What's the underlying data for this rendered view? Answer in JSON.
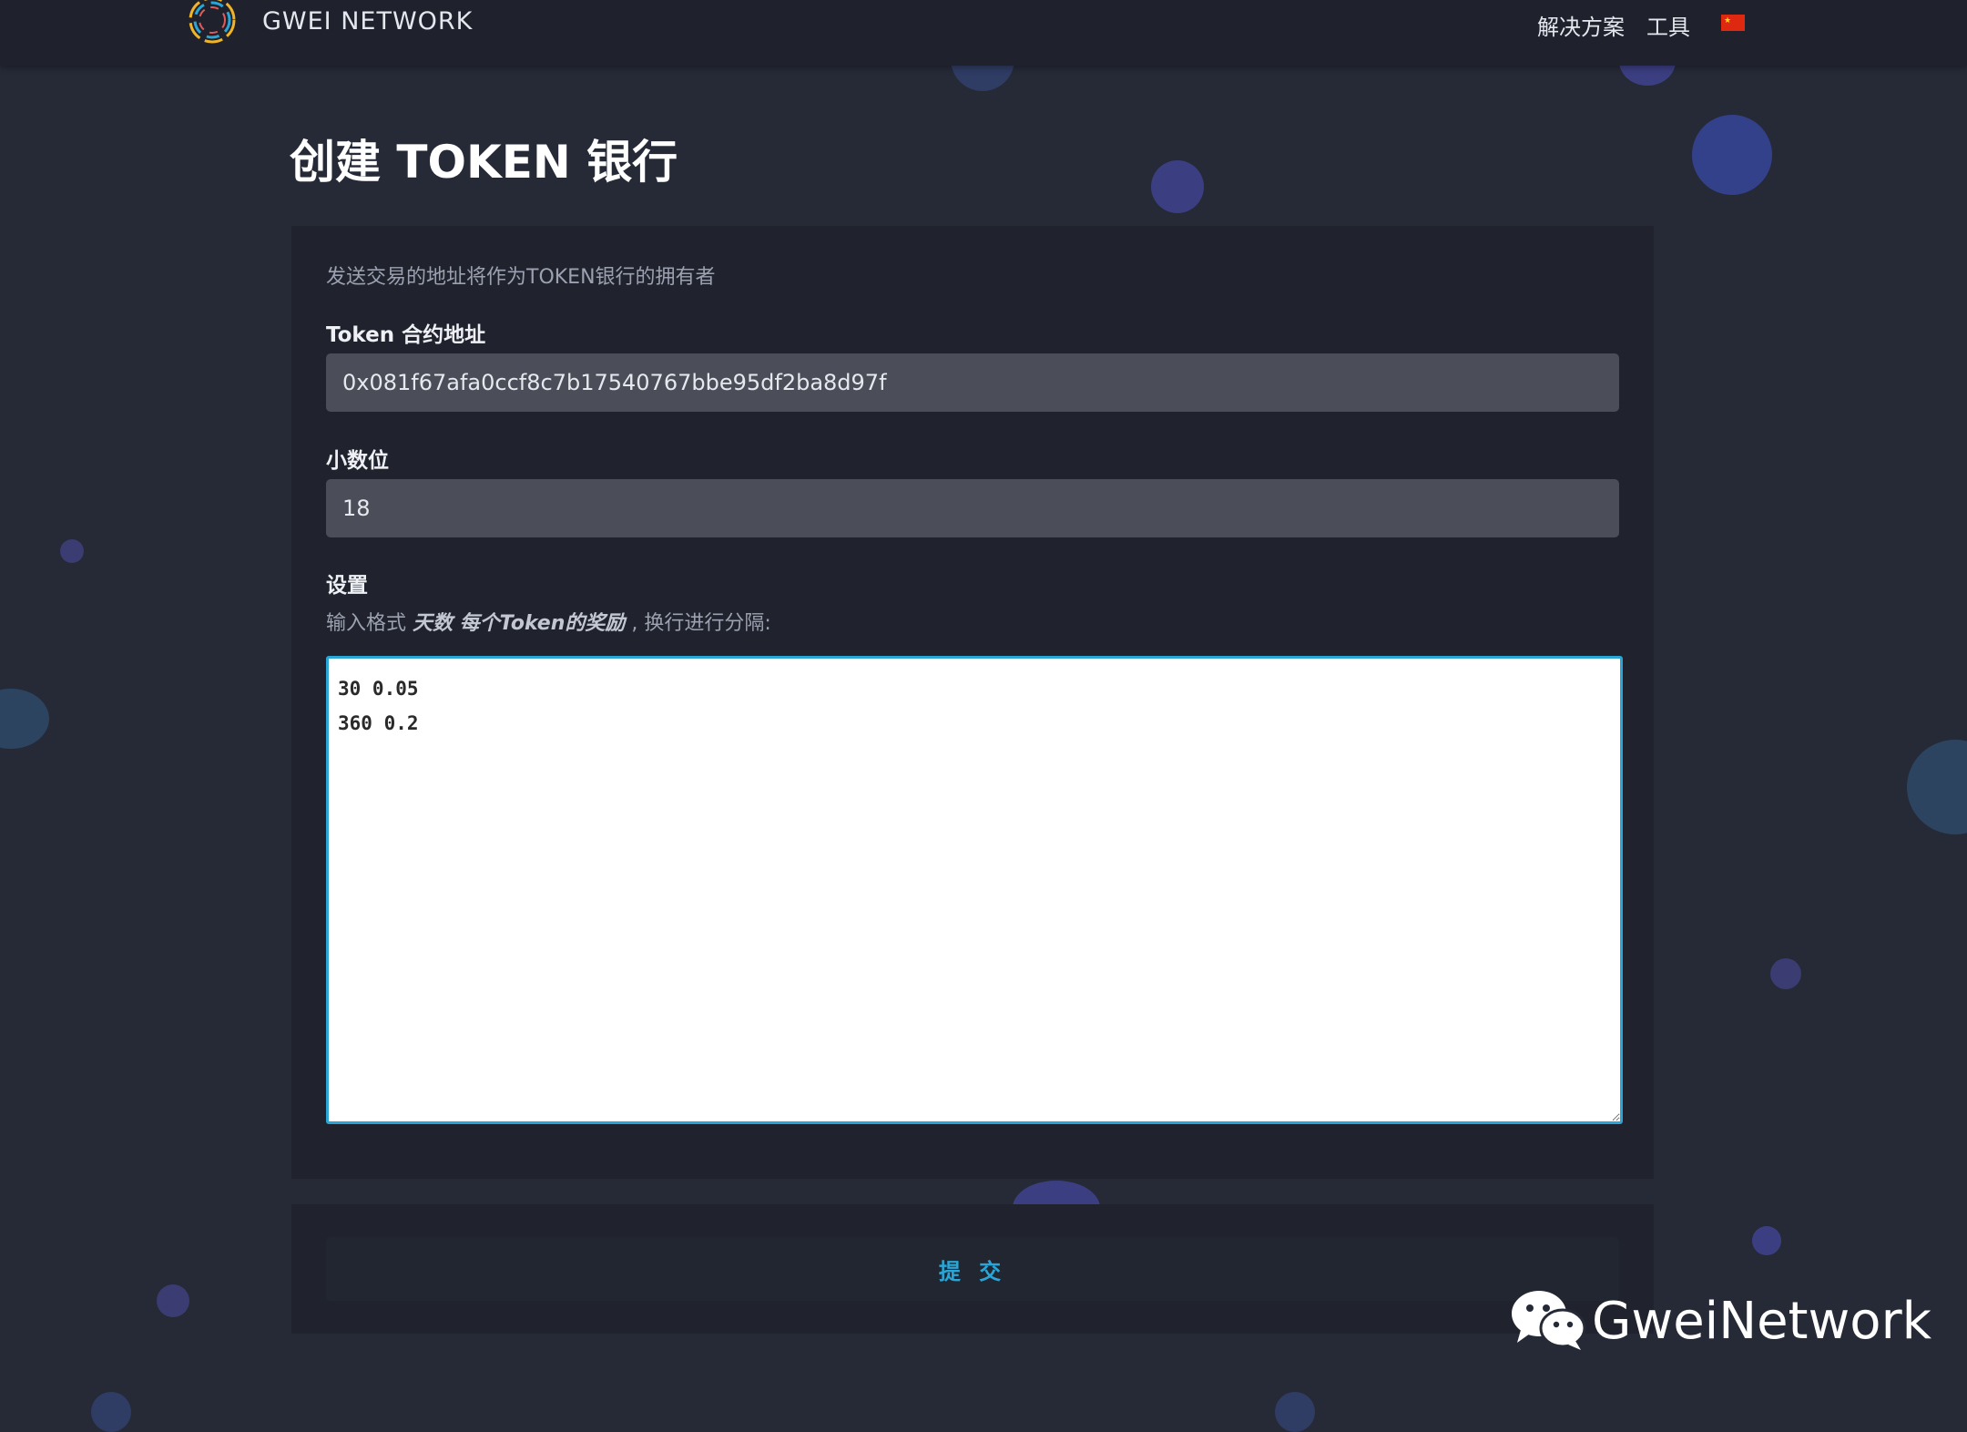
{
  "navbar": {
    "brand": "GWEI NETWORK",
    "links": [
      "解决方案",
      "工具"
    ],
    "flag_icon": "china-flag-icon"
  },
  "page": {
    "title": "创建 TOKEN 银行"
  },
  "form": {
    "hint": "发送交易的地址将作为TOKEN银行的拥有者",
    "token_address": {
      "label": "Token 合约地址",
      "value": "0x081f67afa0ccf8c7b17540767bbe95df2ba8d97f"
    },
    "decimals": {
      "label": "小数位",
      "value": "18"
    },
    "settings": {
      "label": "设置",
      "help_prefix": "输入格式 ",
      "help_emphasis": "天数 每个Token的奖励",
      "help_suffix": " , 换行进行分隔:",
      "value": "30 0.05\n360 0.2"
    },
    "submit_label": "提 交"
  },
  "watermark": {
    "text": "GweiNetwork",
    "icon": "wechat-icon"
  },
  "colors": {
    "background": "#262a37",
    "navbar": "#1f222c",
    "panel": "#20232d",
    "input": "#4b4e59",
    "accent": "#2aa6d6",
    "dot": "#3a3f7a"
  }
}
